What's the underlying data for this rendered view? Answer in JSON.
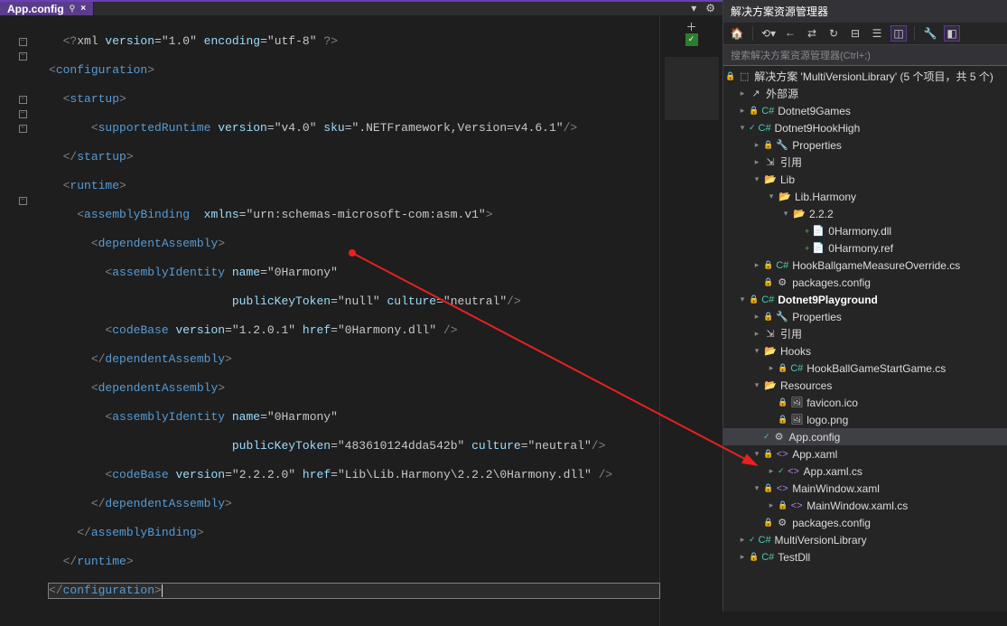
{
  "tab": {
    "name": "App.config",
    "pin": "⚲",
    "close": "×",
    "drop": "▾",
    "gear": "⚙"
  },
  "code": {
    "l1_a": "<?",
    "l1_b": "xml",
    "l1_c": " version",
    "l1_d": "=",
    "l1_e": "\"1.0\"",
    "l1_f": " encoding",
    "l1_g": "=",
    "l1_h": "\"utf-8\"",
    "l1_i": " ?>",
    "l2_a": "<",
    "l2_b": "configuration",
    "l2_c": ">",
    "l3_a": "<",
    "l3_b": "startup",
    "l3_c": ">",
    "l4_a": "<",
    "l4_b": "supportedRuntime",
    "l4_c": " version",
    "l4_d": "=",
    "l4_e": "\"v4.0\"",
    "l4_f": " sku",
    "l4_g": "=",
    "l4_h": "\".NETFramework,Version=v4.6.1\"",
    "l4_i": "/>",
    "l5_a": "</",
    "l5_b": "startup",
    "l5_c": ">",
    "l6_a": "<",
    "l6_b": "runtime",
    "l6_c": ">",
    "l7_a": "<",
    "l7_b": "assemblyBinding",
    "l7_c": "  xmlns",
    "l7_d": "=",
    "l7_e": "\"urn:schemas-microsoft-com:asm.v1\"",
    "l7_f": ">",
    "l8_a": "<",
    "l8_b": "dependentAssembly",
    "l8_c": ">",
    "l9_a": "<",
    "l9_b": "assemblyIdentity",
    "l9_c": " name",
    "l9_d": "=",
    "l9_e": "\"0Harmony\"",
    "l10_a": "publicKeyToken",
    "l10_b": "=",
    "l10_c": "\"null\"",
    "l10_d": " culture",
    "l10_e": "=",
    "l10_f": "\"neutral\"",
    "l10_g": "/>",
    "l11_a": "<",
    "l11_b": "codeBase",
    "l11_c": " version",
    "l11_d": "=",
    "l11_e": "\"1.2.0.1\"",
    "l11_f": " href",
    "l11_g": "=",
    "l11_h": "\"0Harmony.dll\"",
    "l11_i": " />",
    "l12_a": "</",
    "l12_b": "dependentAssembly",
    "l12_c": ">",
    "l13_a": "<",
    "l13_b": "dependentAssembly",
    "l13_c": ">",
    "l14_a": "<",
    "l14_b": "assemblyIdentity",
    "l14_c": " name",
    "l14_d": "=",
    "l14_e": "\"0Harmony\"",
    "l15_a": "publicKeyToken",
    "l15_b": "=",
    "l15_c": "\"483610124dda542b\"",
    "l15_d": " culture",
    "l15_e": "=",
    "l15_f": "\"neutral\"",
    "l15_g": "/>",
    "l16_a": "<",
    "l16_b": "codeBase",
    "l16_c": " version",
    "l16_d": "=",
    "l16_e": "\"2.2.2.0\"",
    "l16_f": " href",
    "l16_g": "=",
    "l16_h": "\"Lib\\Lib.Harmony\\2.2.2\\0Harmony.dll\"",
    "l16_i": " />",
    "l17_a": "</",
    "l17_b": "dependentAssembly",
    "l17_c": ">",
    "l18_a": "</",
    "l18_b": "assemblyBinding",
    "l18_c": ">",
    "l19_a": "</",
    "l19_b": "runtime",
    "l19_c": ">",
    "l20_a": "</",
    "l20_b": "configuration",
    "l20_c": ">"
  },
  "panel": {
    "title": "解决方案资源管理器",
    "search": "搜索解决方案资源管理器(Ctrl+;)",
    "solution": "解决方案 'MultiVersionLibrary' (5 个项目，共 5 个)",
    "ext": "外部源",
    "p1": "Dotnet9Games",
    "p2": "Dotnet9HookHigh",
    "prop": "Properties",
    "ref": "引用",
    "lib": "Lib",
    "libh": "Lib.Harmony",
    "v222": "2.2.2",
    "h1": "0Harmony.dll",
    "h2": "0Harmony.ref",
    "hook1": "HookBallgameMeasureOverride.cs",
    "pkg": "packages.config",
    "p3": "Dotnet9Playground",
    "hooks": "Hooks",
    "hook2": "HookBallGameStartGame.cs",
    "res": "Resources",
    "fav": "favicon.ico",
    "logo": "logo.png",
    "appcfg": "App.config",
    "appxaml": "App.xaml",
    "appxamlcs": "App.xaml.cs",
    "mw": "MainWindow.xaml",
    "mwcs": "MainWindow.xaml.cs",
    "p4": "MultiVersionLibrary",
    "p5": "TestDll"
  },
  "icons": {
    "sln": "🏛",
    "ext": "↗",
    "cs": "C#",
    "folder": "📁",
    "folderc": "📂",
    "wrench": "🔧",
    "refi": "⇲",
    "dll": "🧩",
    "reff": "📄",
    "cfg": "📄",
    "img": "🖼",
    "xaml": "<>",
    "csf": "C#",
    "lock": "🔒",
    "check": "✓",
    "plus": "＋",
    "home": "🏠",
    "refresh": "↻",
    "back": "←",
    "fwd": "⇄",
    "collapse": "⊟",
    "stack": "☰",
    "box": "◫",
    "wr": "🔧"
  }
}
